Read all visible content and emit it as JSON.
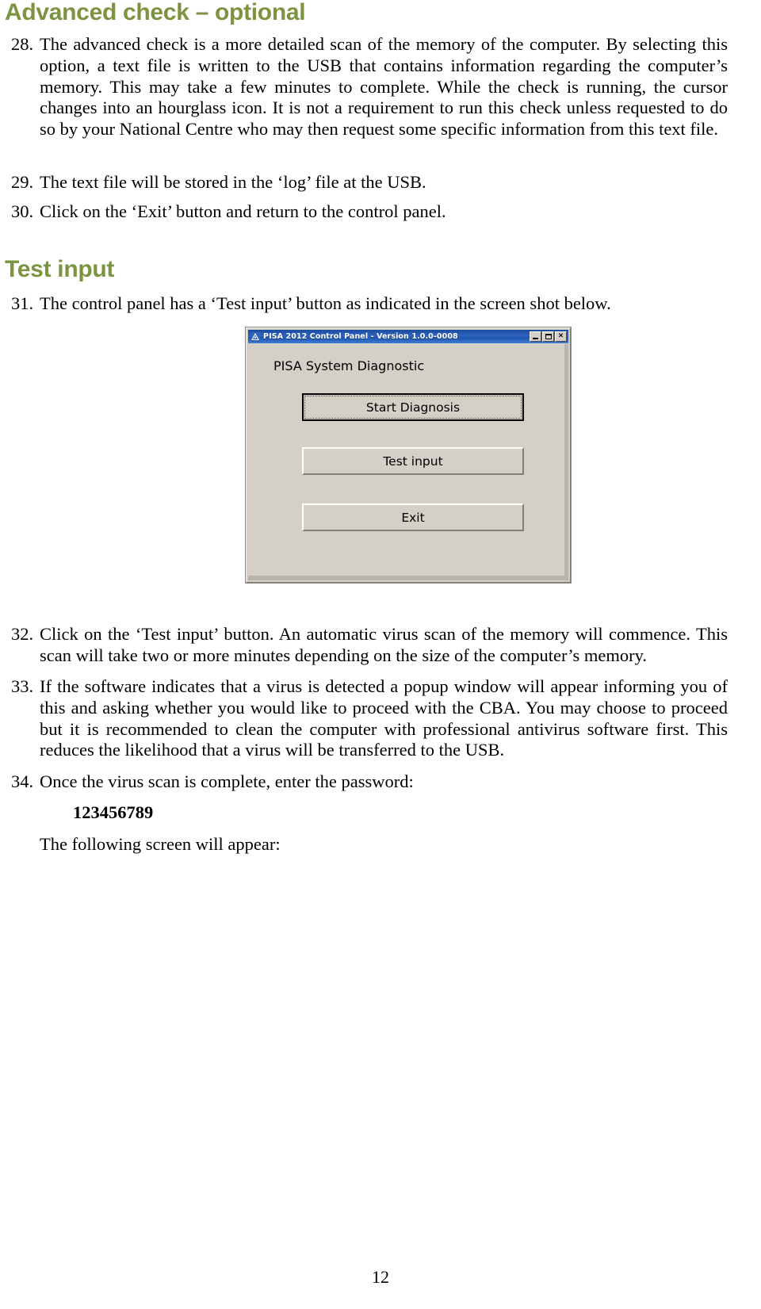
{
  "document": {
    "page_number": "12",
    "headings": {
      "advanced_check": "Advanced check – optional",
      "test_input": "Test input"
    },
    "items": [
      {
        "number": "28.",
        "text": "The advanced check is a more detailed scan of the memory of the computer. By selecting this option, a text file is written to the USB that contains information regarding the computer’s memory. This may take a few minutes to complete. While the check is running, the cursor changes into an hourglass icon. It is not a requirement to run this check unless requested to do so by your National Centre who may then request some specific information from this text file."
      },
      {
        "number": "29.",
        "text": "The text file will be stored in the ‘log’ file at the USB."
      },
      {
        "number": "30.",
        "text": "Click on the ‘Exit’ button and return to the control panel."
      },
      {
        "number": "31.",
        "text": "The control panel has a ‘Test input’ button as indicated in the screen shot below."
      },
      {
        "number": "32.",
        "text": "Click on the ‘Test input’ button. An automatic virus scan of the memory will commence. This scan will take two or more minutes depending on the size of the computer’s memory."
      },
      {
        "number": "33.",
        "text": "If the software indicates that a virus is detected a popup window will appear informing you of this and asking whether you would like to proceed with the CBA. You may choose to proceed but it is recommended to clean the computer with professional antivirus software first. This reduces the likelihood that a virus will be transferred to the USB."
      },
      {
        "number": "34.",
        "text": "Once the virus scan is complete, enter the password:"
      }
    ],
    "password": "123456789",
    "following_screen_text": "The following screen will appear:",
    "heading_color": "#7a9440"
  },
  "screenshot": {
    "window": {
      "title": "PISA 2012 Control Panel - Version 1.0.0-0008",
      "title_icon": "app-icon",
      "titlebar_color": "#2f63bd",
      "client_color": "#d4d0c8",
      "controls": {
        "minimize": "–",
        "maximize": "□",
        "close": "×"
      }
    },
    "client": {
      "label": "PISA System Diagnostic",
      "buttons": [
        {
          "label": "Start Diagnosis",
          "focused": true
        },
        {
          "label": "Test input",
          "focused": false
        },
        {
          "label": "Exit",
          "focused": false
        }
      ]
    }
  }
}
